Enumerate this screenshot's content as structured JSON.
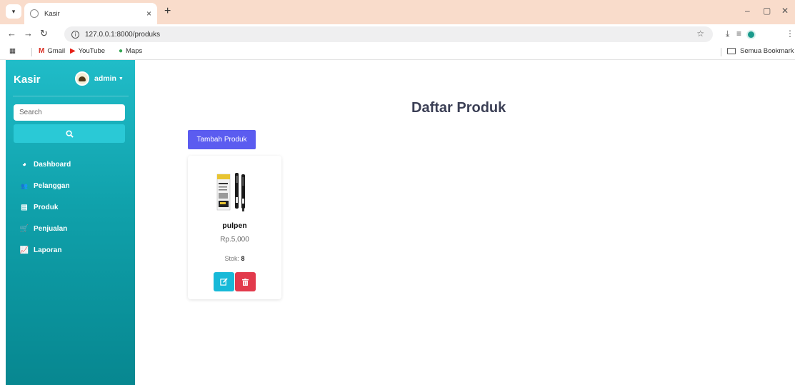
{
  "browser": {
    "tab_title": "Kasir",
    "tab_close": "×",
    "new_tab": "+",
    "url": "127.0.0.1:8000/produks",
    "bookmarks": [
      {
        "label": "Gmail",
        "icon": "gmail-icon"
      },
      {
        "label": "YouTube",
        "icon": "youtube-icon"
      },
      {
        "label": "Maps",
        "icon": "maps-icon"
      }
    ],
    "all_bookmarks": "Semua Bookmark"
  },
  "sidebar": {
    "brand": "Kasir",
    "user": "admin",
    "search_placeholder": "Search",
    "menu": [
      {
        "label": "Dashboard",
        "icon": "dashboard-icon"
      },
      {
        "label": "Pelanggan",
        "icon": "users-icon"
      },
      {
        "label": "Produk",
        "icon": "box-icon"
      },
      {
        "label": "Penjualan",
        "icon": "cart-icon"
      },
      {
        "label": "Laporan",
        "icon": "chart-icon"
      }
    ]
  },
  "main": {
    "title": "Daftar Produk",
    "add_button": "Tambah Produk",
    "products": [
      {
        "name": "pulpen",
        "price": "Rp.5,000",
        "stock_label": "Stok:",
        "stock": "8"
      }
    ]
  },
  "colors": {
    "sidebar_top": "#20bcc8",
    "sidebar_bottom": "#078790",
    "primary_button": "#5b5cf0",
    "edit_button": "#17b9d8",
    "delete_button": "#e23a4c",
    "tabstrip": "#f9dccb"
  }
}
